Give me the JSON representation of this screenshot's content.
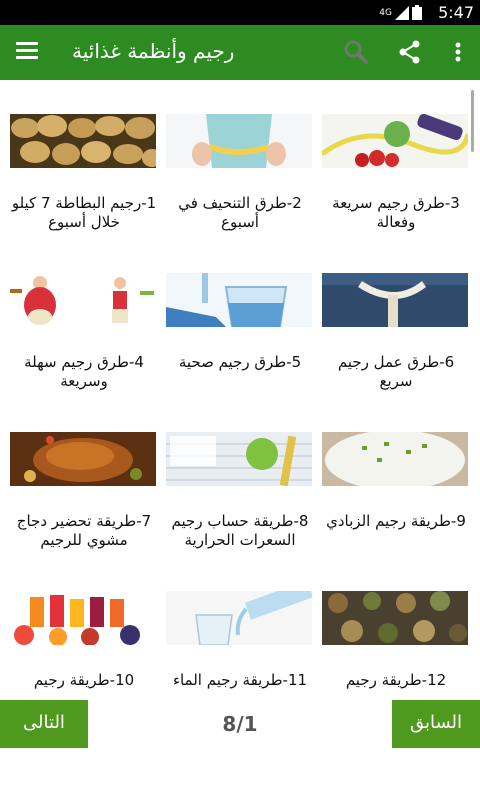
{
  "status_bar": {
    "network": "4G",
    "time": "5:47"
  },
  "app_bar": {
    "title": "رجيم وأنظمة غذائية"
  },
  "articles": [
    {
      "label": "1-رجيم البطاطة 7 كيلو خلال أسبوع",
      "image": "potatoes"
    },
    {
      "label": "2-طرق التنحيف في أسبوع",
      "image": "waist-measuring-tape"
    },
    {
      "label": "3-طرق رجيم سريعة وفعالة",
      "image": "fruit-and-dumbbells"
    },
    {
      "label": "4-طرق رجيم سهلة وسريعة",
      "image": "before-after-cartoon"
    },
    {
      "label": "5-طرق رجيم صحية",
      "image": "glass-of-water"
    },
    {
      "label": "6-طرق عمل رجيم سريع",
      "image": "jeans-measuring-tape"
    },
    {
      "label": "7-طريقة تحضير دجاج مشوي للرجيم",
      "image": "roast-chicken"
    },
    {
      "label": "8-طريقة حساب رجيم السعرات الحرارية",
      "image": "apple-on-chart"
    },
    {
      "label": "9-طريقة رجيم الزبادي",
      "image": "yogurt-bowl"
    },
    {
      "label": "10-طريقة رجيم",
      "image": "juices-and-fruit"
    },
    {
      "label": "11-طريقة رجيم الماء",
      "image": "water-pouring"
    },
    {
      "label": "12-طريقة رجيم",
      "image": "herbs-and-spices"
    }
  ],
  "pagination": {
    "next_label": "التالى",
    "prev_label": "السابق",
    "indicator": "8/1"
  },
  "colors": {
    "app_bar": "#2e8b22",
    "button": "#4f9a1e"
  }
}
